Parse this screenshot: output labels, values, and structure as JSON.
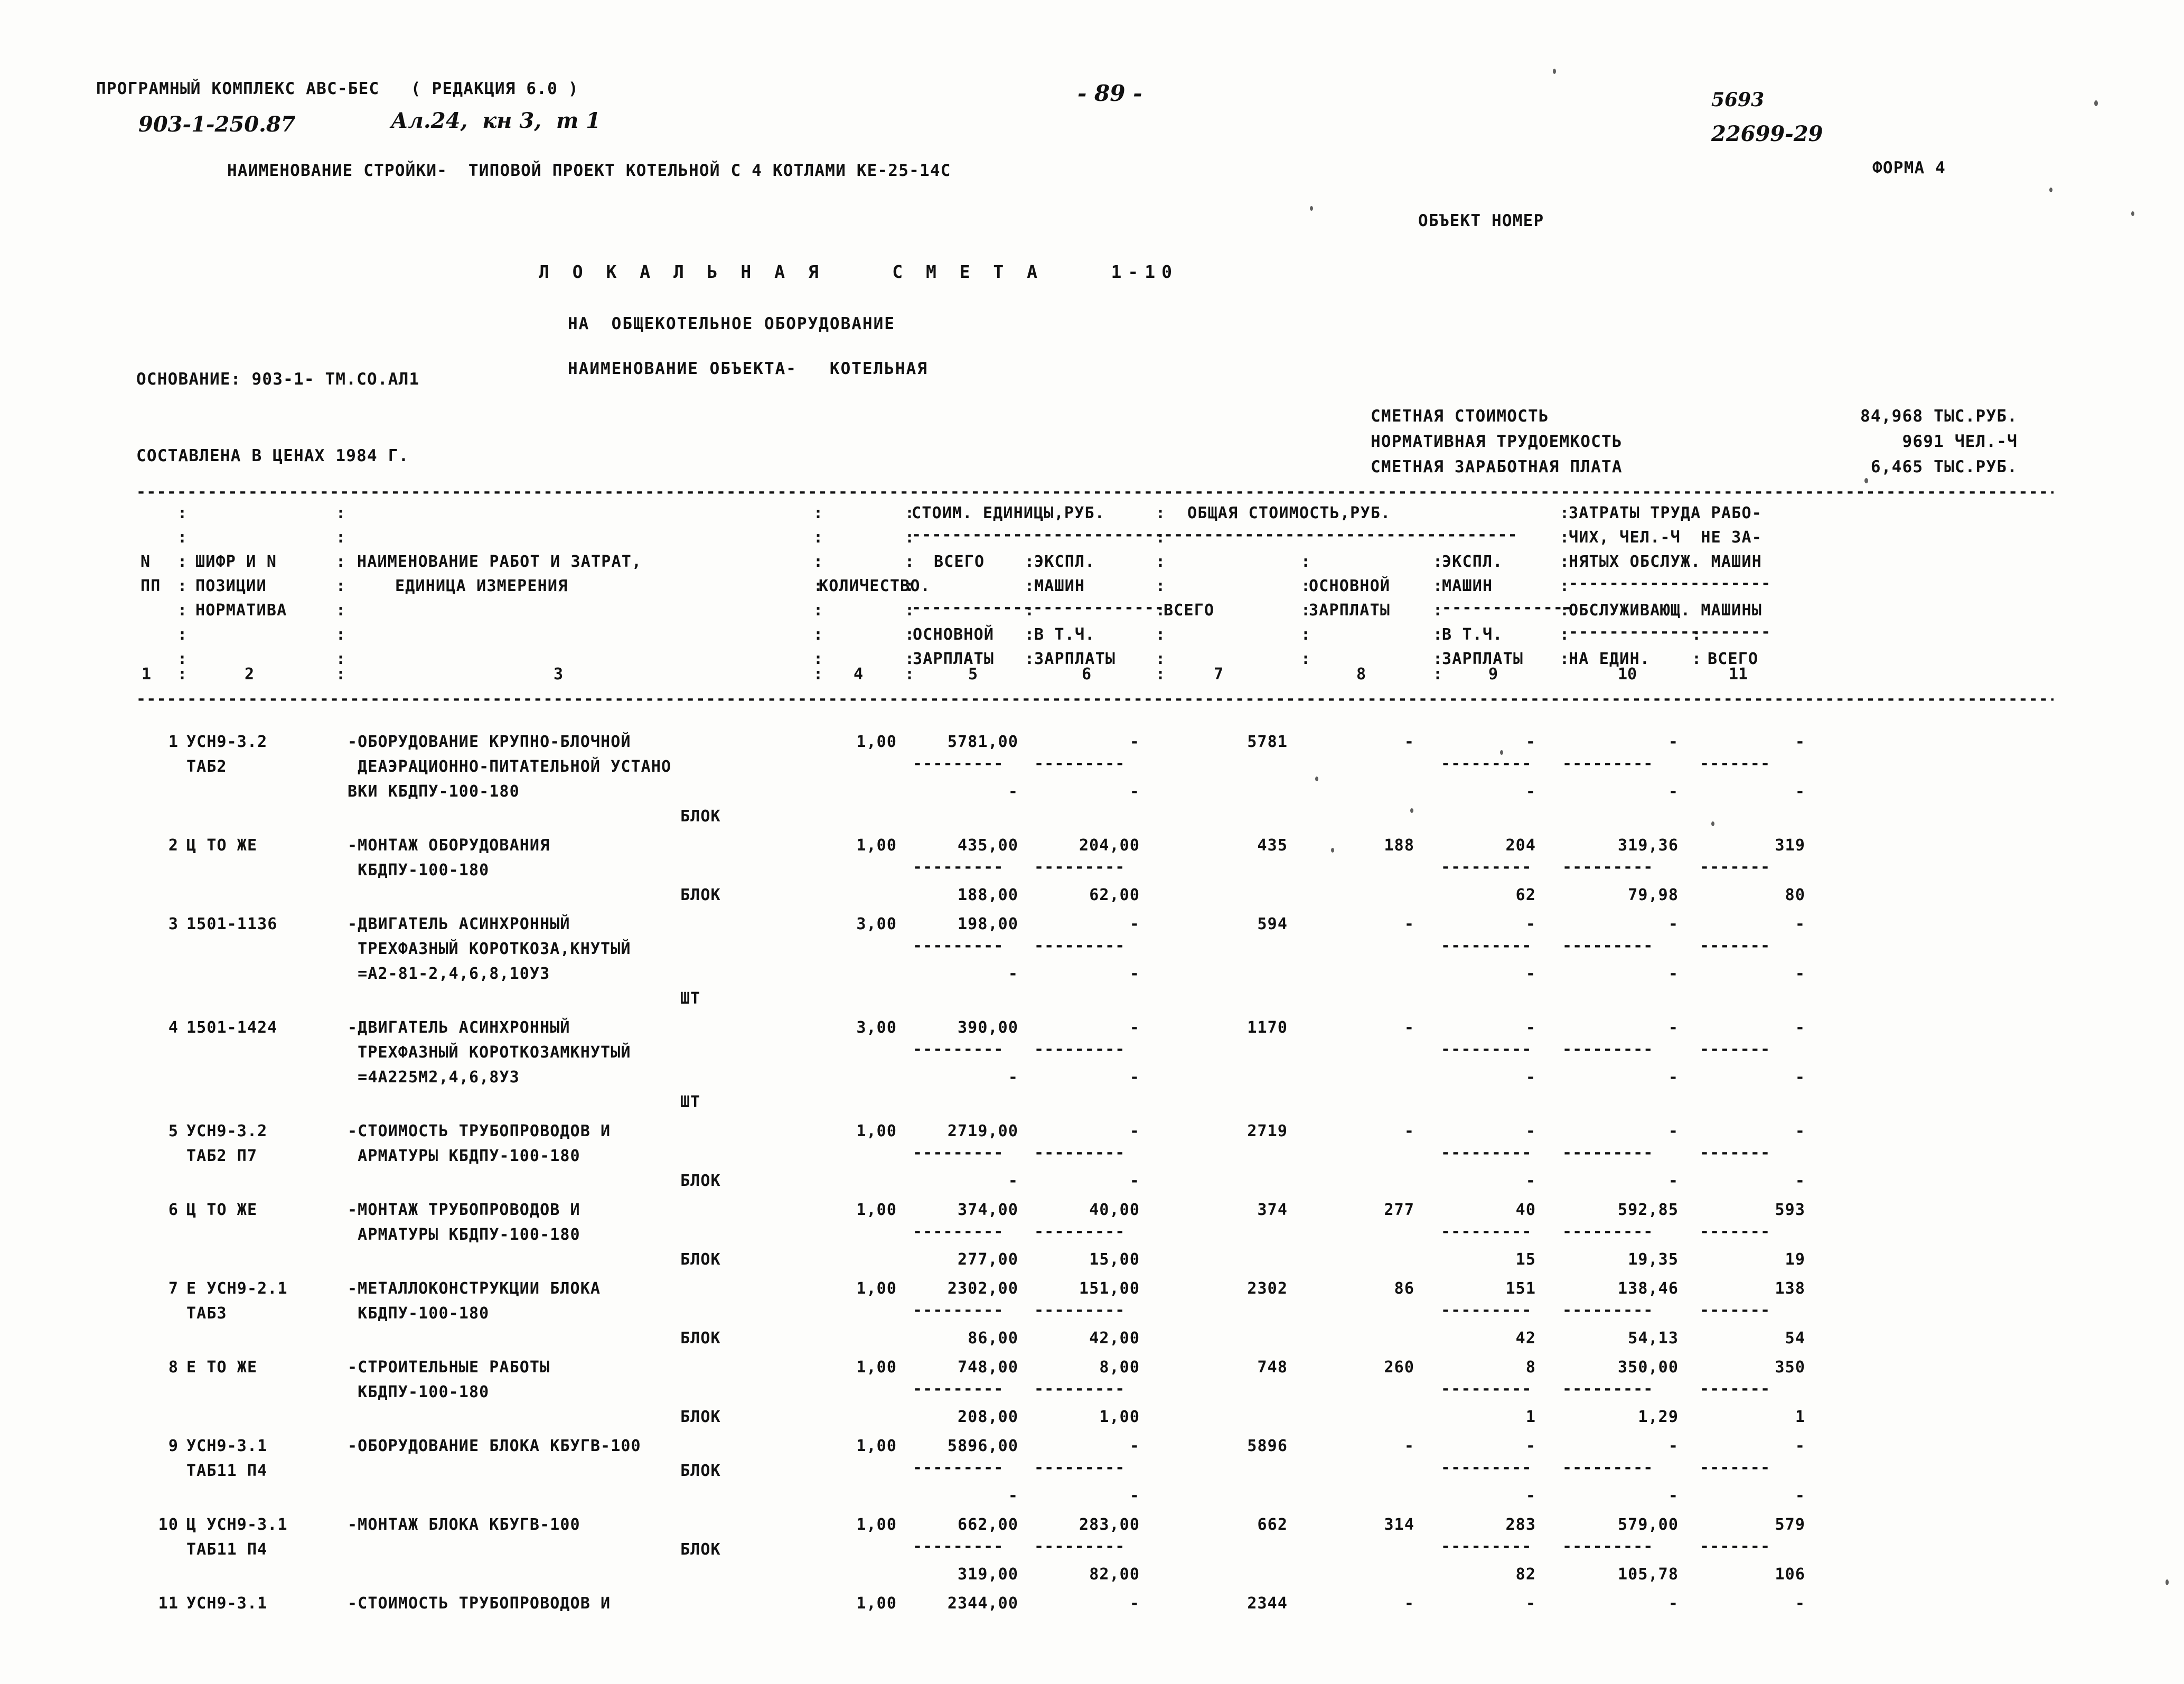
{
  "header": {
    "program": "ПРОГРАМНЫЙ КОМПЛЕКС АВС-БЕС   ( РЕДАКЦИЯ 6.0 )",
    "project_code": "903-1-250.87",
    "album": "Ал.24,  кн 3,  т 1",
    "page_number": "- 89 -",
    "doc_number_1": "5693",
    "doc_number_2": "22699-29",
    "form_label": "ФОРМА 4",
    "stroyka_line": "НАИМЕНОВАНИЕ СТРОЙКИ-  ТИПОВОЙ ПРОЕКТ КОТЕЛЬНОЙ С 4 КОТЛАМИ КЕ-25-14С",
    "object_number_label": "ОБЪЕКТ НОМЕР"
  },
  "title": {
    "smeta": "Л О К А Л Ь Н А Я    С М Е Т А    1-10",
    "subject": "НА  ОБЩЕКОТЕЛЬНОЕ ОБОРУДОВАНИЕ",
    "object_name": "НАИМЕНОВАНИЕ ОБЪЕКТА-   КОТЕЛЬНАЯ"
  },
  "basis": {
    "osnovanie": "ОСНОВАНИЕ: 903-1- ТМ.СО.АЛ1",
    "sostavlena": "СОСТАВЛЕНА В ЦЕНАХ 1984 Г."
  },
  "summary": [
    {
      "label": "СМЕТНАЯ СТОИМОСТЬ",
      "value": "84,968 ТЫС.РУБ."
    },
    {
      "label": "НОРМАТИВНАЯ ТРУДОЕМКОСТЬ",
      "value": "9691 ЧЕЛ.-Ч"
    },
    {
      "label": "СМЕТНАЯ ЗАРАБОТНАЯ ПЛАТА",
      "value": "6,465 ТЫС.РУБ."
    }
  ],
  "table": {
    "rule_char": "-",
    "header": {
      "np_1": "N",
      "np_2": "ПП",
      "shifr_1": "ШИФР И N",
      "shifr_2": "ПОЗИЦИИ",
      "shifr_3": "НОРМАТИВА",
      "name_1": "НАИМЕНОВАНИЕ РАБОТ И ЗАТРАТ,",
      "name_2": "ЕДИНИЦА ИЗМЕРЕНИЯ",
      "kolvo": "КОЛИЧЕСТВО.",
      "stoim_group": "СТОИМ. ЕДИНИЦЫ,РУБ.",
      "stoim_vsego": "ВСЕГО",
      "stoim_eksp_1": "ЭКСПЛ.",
      "stoim_eksp_2": "МАШИН",
      "stoim_osn_1": "ОСНОВНОЙ",
      "stoim_osn_2": "ЗАРПЛАТЫ",
      "stoim_tch_1": "В Т.Ч.",
      "stoim_tch_2": "ЗАРПЛАТЫ",
      "obsh_group": "ОБЩАЯ СТОИМОСТЬ,РУБ.",
      "obsh_vsego": "ВСЕГО",
      "obsh_osn_1": "ОСНОВНОЙ",
      "obsh_osn_2": "ЗАРПЛАТЫ",
      "obsh_eksp_1": "ЭКСПЛ.",
      "obsh_eksp_2": "МАШИН",
      "obsh_tch_1": "В Т.Ч.",
      "obsh_tch_2": "ЗАРПЛАТЫ",
      "zatr_1": "ЗАТРАТЫ ТРУДА РАБО-",
      "zatr_2": "ЧИХ, ЧЕЛ.-Ч  НЕ ЗА-",
      "zatr_3": "НЯТЫХ ОБСЛУЖ. МАШИН",
      "zatr_4": "ОБСЛУЖИВАЮЩ. МАШИНЫ",
      "zatr_ed": "НА ЕДИН.",
      "zatr_all": "ВСЕГО"
    },
    "column_numbers": [
      "1",
      "2",
      "3",
      "4",
      "5",
      "6",
      "7",
      "8",
      "9",
      "10",
      "11"
    ],
    "rows": [
      {
        "np": "1",
        "shifr": [
          "УСН9-3.2",
          "ТАБ2"
        ],
        "name": [
          "-ОБОРУДОВАНИЕ КРУПНО-БЛОЧНОЙ",
          " ДЕАЭРАЦИОННО-ПИТАТЕЛЬНОЙ УСТАНО",
          "ВКИ КБДПУ-100-180"
        ],
        "unit": "БЛОК",
        "qty": "1,00",
        "stoim_vsego": "5781,00",
        "stoim_mash": "-",
        "obsh_vsego": "5781",
        "obsh_zp": "-",
        "obsh_mash": "-",
        "zatr_ed": "-",
        "zatr_all": "-",
        "sub_vsego": "-",
        "sub_mash": "-",
        "sub_emash": "-",
        "sub_ed": "-",
        "sub_all": "-"
      },
      {
        "np": "2",
        "shifr": [
          "Ц ТО ЖЕ"
        ],
        "name": [
          "-МОНТАЖ ОБОРУДОВАНИЯ",
          " КБДПУ-100-180"
        ],
        "unit": "БЛОК",
        "qty": "1,00",
        "stoim_vsego": "435,00",
        "stoim_mash": "204,00",
        "obsh_vsego": "435",
        "obsh_zp": "188",
        "obsh_mash": "204",
        "zatr_ed": "319,36",
        "zatr_all": "319",
        "sub_vsego": "188,00",
        "sub_mash": "62,00",
        "sub_emash": "62",
        "sub_ed": "79,98",
        "sub_all": "80"
      },
      {
        "np": "3",
        "shifr": [
          "1501-1136"
        ],
        "name": [
          "-ДВИГАТЕЛЬ АСИНХРОННЫЙ",
          " ТРЕХФАЗНЫЙ КОРОТКОЗА,КНУТЫЙ",
          " =А2-81-2,4,6,8,10У3"
        ],
        "unit": "ШТ",
        "qty": "3,00",
        "stoim_vsego": "198,00",
        "stoim_mash": "-",
        "obsh_vsego": "594",
        "obsh_zp": "-",
        "obsh_mash": "-",
        "zatr_ed": "-",
        "zatr_all": "-",
        "sub_vsego": "-",
        "sub_mash": "-",
        "sub_emash": "-",
        "sub_ed": "-",
        "sub_all": "-"
      },
      {
        "np": "4",
        "shifr": [
          "1501-1424"
        ],
        "name": [
          "-ДВИГАТЕЛЬ АСИНХРОННЫЙ",
          " ТРЕХФАЗНЫЙ КОРОТКОЗАМКНУТЫЙ",
          " =4А225М2,4,6,8У3"
        ],
        "unit": "ШТ",
        "qty": "3,00",
        "stoim_vsego": "390,00",
        "stoim_mash": "-",
        "obsh_vsego": "1170",
        "obsh_zp": "-",
        "obsh_mash": "-",
        "zatr_ed": "-",
        "zatr_all": "-",
        "sub_vsego": "-",
        "sub_mash": "-",
        "sub_emash": "-",
        "sub_ed": "-",
        "sub_all": "-"
      },
      {
        "np": "5",
        "shifr": [
          "УСН9-3.2",
          "ТАБ2 П7"
        ],
        "name": [
          "-СТОИМОСТЬ ТРУБОПРОВОДОВ И",
          " АРМАТУРЫ КБДПУ-100-180"
        ],
        "unit": "БЛОК",
        "qty": "1,00",
        "stoim_vsego": "2719,00",
        "stoim_mash": "-",
        "obsh_vsego": "2719",
        "obsh_zp": "-",
        "obsh_mash": "-",
        "zatr_ed": "-",
        "zatr_all": "-",
        "sub_vsego": "-",
        "sub_mash": "-",
        "sub_emash": "-",
        "sub_ed": "-",
        "sub_all": "-"
      },
      {
        "np": "6",
        "shifr": [
          "Ц ТО ЖЕ"
        ],
        "name": [
          "-МОНТАЖ ТРУБОПРОВОДОВ И",
          " АРМАТУРЫ КБДПУ-100-180"
        ],
        "unit": "БЛОК",
        "qty": "1,00",
        "stoim_vsego": "374,00",
        "stoim_mash": "40,00",
        "obsh_vsego": "374",
        "obsh_zp": "277",
        "obsh_mash": "40",
        "zatr_ed": "592,85",
        "zatr_all": "593",
        "sub_vsego": "277,00",
        "sub_mash": "15,00",
        "sub_emash": "15",
        "sub_ed": "19,35",
        "sub_all": "19"
      },
      {
        "np": "7",
        "shifr": [
          "Е УСН9-2.1",
          "ТАБ3"
        ],
        "name": [
          "-МЕТАЛЛОКОНСТРУКЦИИ БЛОКА",
          " КБДПУ-100-180"
        ],
        "unit": "БЛОК",
        "qty": "1,00",
        "stoim_vsego": "2302,00",
        "stoim_mash": "151,00",
        "obsh_vsego": "2302",
        "obsh_zp": "86",
        "obsh_mash": "151",
        "zatr_ed": "138,46",
        "zatr_all": "138",
        "sub_vsego": "86,00",
        "sub_mash": "42,00",
        "sub_emash": "42",
        "sub_ed": "54,13",
        "sub_all": "54"
      },
      {
        "np": "8",
        "shifr": [
          "Е ТО ЖЕ"
        ],
        "name": [
          "-СТРОИТЕЛЬНЫЕ РАБОТЫ",
          " КБДПУ-100-180"
        ],
        "unit": "БЛОК",
        "qty": "1,00",
        "stoim_vsego": "748,00",
        "stoim_mash": "8,00",
        "obsh_vsego": "748",
        "obsh_zp": "260",
        "obsh_mash": "8",
        "zatr_ed": "350,00",
        "zatr_all": "350",
        "sub_vsego": "208,00",
        "sub_mash": "1,00",
        "sub_emash": "1",
        "sub_ed": "1,29",
        "sub_all": "1"
      },
      {
        "np": "9",
        "shifr": [
          "УСН9-3.1",
          "ТАБ11 П4"
        ],
        "name": [
          "-ОБОРУДОВАНИЕ БЛОКА КБУГВ-100"
        ],
        "unit": "БЛОК",
        "qty": "1,00",
        "stoim_vsego": "5896,00",
        "stoim_mash": "-",
        "obsh_vsego": "5896",
        "obsh_zp": "-",
        "obsh_mash": "-",
        "zatr_ed": "-",
        "zatr_all": "-",
        "sub_vsego": "-",
        "sub_mash": "-",
        "sub_emash": "-",
        "sub_ed": "-",
        "sub_all": "-"
      },
      {
        "np": "10",
        "shifr": [
          "Ц УСН9-3.1",
          "ТАБ11 П4"
        ],
        "name": [
          "-МОНТАЖ БЛОКА КБУГВ-100"
        ],
        "unit": "БЛОК",
        "qty": "1,00",
        "stoim_vsego": "662,00",
        "stoim_mash": "283,00",
        "obsh_vsego": "662",
        "obsh_zp": "314",
        "obsh_mash": "283",
        "zatr_ed": "579,00",
        "zatr_all": "579",
        "sub_vsego": "319,00",
        "sub_mash": "82,00",
        "sub_emash": "82",
        "sub_ed": "105,78",
        "sub_all": "106"
      },
      {
        "np": "11",
        "shifr": [
          "УСН9-3.1"
        ],
        "name": [
          "-СТОИМОСТЬ ТРУБОПРОВОДОВ И"
        ],
        "unit": "",
        "qty": "1,00",
        "stoim_vsego": "2344,00",
        "stoim_mash": "-",
        "obsh_vsego": "2344",
        "obsh_zp": "-",
        "obsh_mash": "-",
        "zatr_ed": "-",
        "zatr_all": "-",
        "sub_vsego": "",
        "sub_mash": "",
        "sub_emash": "",
        "sub_ed": "",
        "sub_all": ""
      }
    ]
  }
}
